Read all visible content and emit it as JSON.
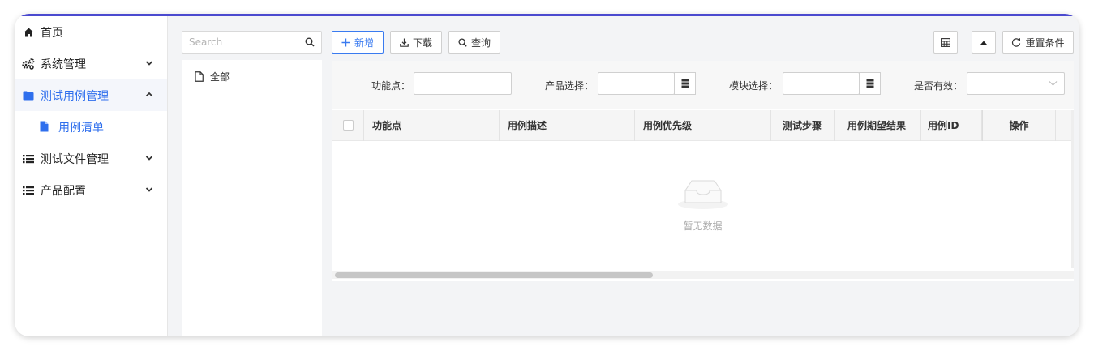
{
  "sidebar": {
    "items": [
      {
        "label": "首页",
        "icon": "home-icon"
      },
      {
        "label": "系统管理",
        "icon": "gears-icon"
      },
      {
        "label": "测试用例管理",
        "icon": "folder-icon"
      },
      {
        "label": "测试文件管理",
        "icon": "list-icon"
      },
      {
        "label": "产品配置",
        "icon": "list-icon"
      }
    ],
    "sub_item": {
      "label": "用例清单",
      "icon": "file-icon"
    }
  },
  "tree": {
    "search_placeholder": "Search",
    "root_label": "全部"
  },
  "toolbar": {
    "add_label": "新增",
    "download_label": "下载",
    "query_label": "查询",
    "reset_label": "重置条件"
  },
  "filters": {
    "feature_label": "功能点：",
    "product_label": "产品选择：",
    "module_label": "模块选择：",
    "valid_label": "是否有效："
  },
  "table": {
    "columns": [
      "功能点",
      "用例描述",
      "用例优先级",
      "测试步骤",
      "用例期望结果",
      "用例ID",
      "操作"
    ],
    "empty_text": "暂无数据"
  },
  "colors": {
    "accent": "#2f6fed",
    "topbar": "#4b4acf"
  }
}
